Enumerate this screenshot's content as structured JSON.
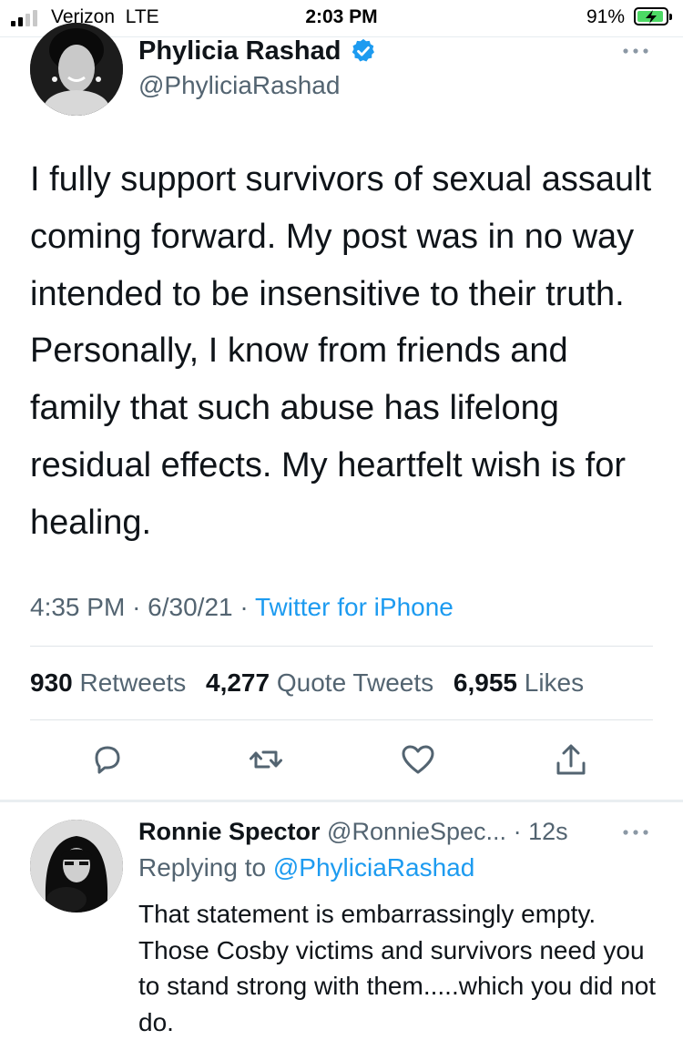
{
  "status_bar": {
    "carrier": "Verizon",
    "network": "LTE",
    "time": "2:03 PM",
    "battery": "91%",
    "battery_level": 0.91,
    "signal_bars": 2,
    "signal_bars_total": 4
  },
  "tweet": {
    "author_name": "Phylicia Rashad",
    "author_handle": "@PhyliciaRashad",
    "verified": true,
    "text": "I fully support survivors of sexual assault coming forward. My post was in no way intended to be insensitive to their truth. Personally, I know from friends and family that such abuse has lifelong residual effects. My heartfelt wish is for healing.",
    "time": "4:35 PM",
    "date": "6/30/21",
    "separator": "·",
    "source": "Twitter for iPhone",
    "stats": {
      "retweets_count": "930",
      "retweets_label": "Retweets",
      "quotes_count": "4,277",
      "quotes_label": "Quote Tweets",
      "likes_count": "6,955",
      "likes_label": "Likes"
    },
    "actions": [
      "reply-icon",
      "retweet-icon",
      "like-icon",
      "share-icon"
    ]
  },
  "reply": {
    "author_name": "Ronnie Spector",
    "author_handle": "@RonnieSpec...",
    "time": "· 12s",
    "replying_prefix": "Replying to",
    "replying_to": "@PhyliciaRashad",
    "text": "That statement is embarrassingly empty. Those Cosby victims and survivors need you to stand strong with them.....which you did not do."
  },
  "colors": {
    "link": "#1d9bf0",
    "muted_text": "#536471",
    "verified": "#1d9bf0",
    "battery_fill": "#4cd964"
  }
}
